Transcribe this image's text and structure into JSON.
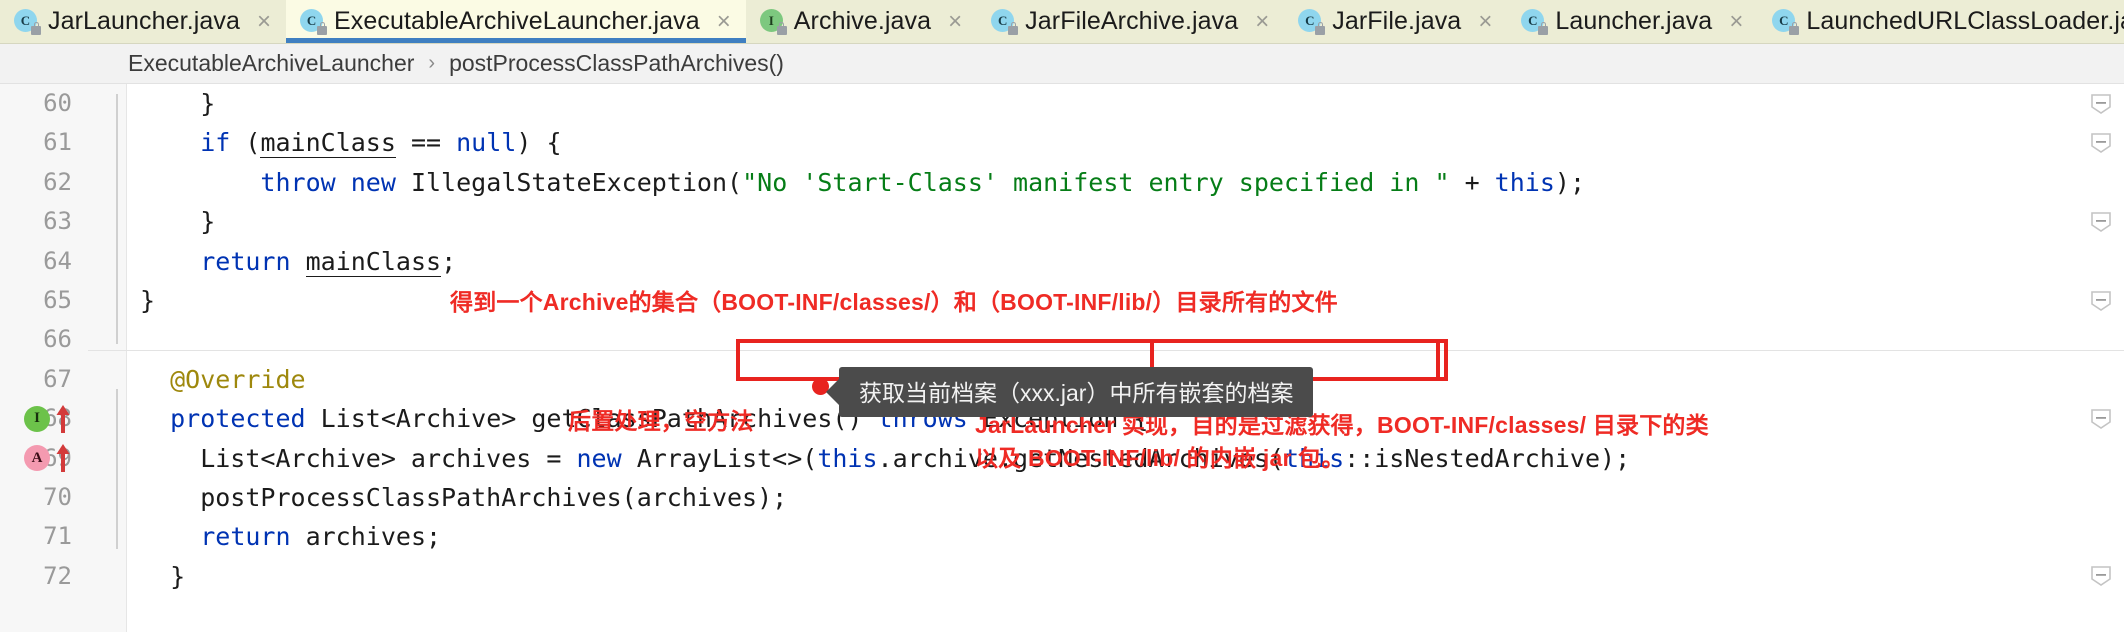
{
  "tabs": [
    {
      "label": "JarLauncher.java",
      "icon": "java-class-icon",
      "kind": "cls",
      "badge": "C",
      "active": false,
      "close": "×"
    },
    {
      "label": "ExecutableArchiveLauncher.java",
      "icon": "java-class-icon",
      "kind": "cls",
      "badge": "C",
      "active": true,
      "close": "×"
    },
    {
      "label": "Archive.java",
      "icon": "java-interface-icon",
      "kind": "iface",
      "badge": "I",
      "active": false,
      "close": "×"
    },
    {
      "label": "JarFileArchive.java",
      "icon": "java-class-icon",
      "kind": "cls",
      "badge": "C",
      "active": false,
      "close": "×"
    },
    {
      "label": "JarFile.java",
      "icon": "java-class-icon",
      "kind": "cls",
      "badge": "C",
      "active": false,
      "close": "×"
    },
    {
      "label": "Launcher.java",
      "icon": "java-class-icon",
      "kind": "cls",
      "badge": "C",
      "active": false,
      "close": "×"
    },
    {
      "label": "LaunchedURLClassLoader.java",
      "icon": "java-class-icon",
      "kind": "cls",
      "badge": "C",
      "active": false,
      "close": ""
    }
  ],
  "breadcrumb": {
    "class": "ExecutableArchiveLauncher",
    "separator": "›",
    "member": "postProcessClassPathArchives()"
  },
  "editor": {
    "lines": [
      {
        "num": "60",
        "indent": 0
      },
      {
        "num": "61",
        "indent": 0
      },
      {
        "num": "62",
        "indent": 0
      },
      {
        "num": "63",
        "indent": 0
      },
      {
        "num": "64",
        "indent": 0
      },
      {
        "num": "65",
        "indent": 0
      },
      {
        "num": "66",
        "indent": 0
      },
      {
        "num": "67",
        "indent": 0
      },
      {
        "num": "68",
        "indent": 0
      },
      {
        "num": "69",
        "indent": 0
      },
      {
        "num": "70",
        "indent": 0
      },
      {
        "num": "71",
        "indent": 0
      },
      {
        "num": "72",
        "indent": 0
      }
    ],
    "gutter_markers": {
      "line68": {
        "badge": "I",
        "name": "implemented-method-marker",
        "arrow": "red-up-arrow"
      },
      "line69": {
        "badge": "A",
        "name": "overridden-method-marker",
        "arrow": "red-up-arrow"
      }
    }
  },
  "annotations": {
    "line67_note": "得到一个Archive的集合（BOOT-INF/classes/）和（BOOT-INF/lib/）目录所有的文件",
    "line71_note": "后置处理，空方法",
    "bottom_note_line1": "JarLauncher 实现，目的是过滤获得，BOOT-INF/classes/ 目录下的类",
    "bottom_note_line2": "以及 BOOT-INF/lib/ 的内嵌 jar 包。",
    "tooltip": "获取当前档案（xxx.jar）中所有嵌套的档案"
  },
  "code": {
    "l60": {
      "seg": [
        {
          "t": "    }",
          "c": "pl"
        }
      ]
    },
    "l61": {
      "seg": [
        {
          "t": "    ",
          "c": "pl"
        },
        {
          "t": "if",
          "c": "kw"
        },
        {
          "t": " (",
          "c": "pl"
        },
        {
          "t": "mainClass",
          "c": "fld"
        },
        {
          "t": " == ",
          "c": "pl"
        },
        {
          "t": "null",
          "c": "kw"
        },
        {
          "t": ") {",
          "c": "pl"
        }
      ]
    },
    "l62": {
      "seg": [
        {
          "t": "        ",
          "c": "pl"
        },
        {
          "t": "throw",
          "c": "kw"
        },
        {
          "t": " ",
          "c": "pl"
        },
        {
          "t": "new",
          "c": "kw"
        },
        {
          "t": " IllegalStateException(",
          "c": "pl"
        },
        {
          "t": "\"No 'Start-Class' manifest entry specified in \"",
          "c": "str"
        },
        {
          "t": " + ",
          "c": "pl"
        },
        {
          "t": "this",
          "c": "kw"
        },
        {
          "t": ");",
          "c": "pl"
        }
      ]
    },
    "l63": {
      "seg": [
        {
          "t": "    }",
          "c": "pl"
        }
      ]
    },
    "l64": {
      "seg": [
        {
          "t": "    ",
          "c": "pl"
        },
        {
          "t": "return",
          "c": "kw"
        },
        {
          "t": " ",
          "c": "pl"
        },
        {
          "t": "mainClass",
          "c": "fld"
        },
        {
          "t": ";",
          "c": "pl"
        }
      ]
    },
    "l65": {
      "seg": [
        {
          "t": "}",
          "c": "pl"
        }
      ]
    },
    "l66": {
      "seg": [
        {
          "t": "",
          "c": "pl"
        }
      ]
    },
    "l67": {
      "seg": [
        {
          "t": "  ",
          "c": "pl"
        },
        {
          "t": "@Override",
          "c": "ann"
        }
      ]
    },
    "l68": {
      "seg": [
        {
          "t": "  ",
          "c": "pl"
        },
        {
          "t": "protected",
          "c": "kw"
        },
        {
          "t": " List<Archive> getClassPathArchives() ",
          "c": "pl"
        },
        {
          "t": "throws",
          "c": "kw"
        },
        {
          "t": " Exception {",
          "c": "pl"
        }
      ]
    },
    "l69": {
      "seg": [
        {
          "t": "    List<Archive> archives = ",
          "c": "pl"
        },
        {
          "t": "new",
          "c": "kw"
        },
        {
          "t": " ArrayList<>(",
          "c": "pl"
        },
        {
          "t": "this",
          "c": "kw"
        },
        {
          "t": ".archive.getNestedArchives(",
          "c": "pl"
        },
        {
          "t": "this",
          "c": "kw"
        },
        {
          "t": "::isNestedArchive);",
          "c": "pl"
        }
      ]
    },
    "l70": {
      "seg": [
        {
          "t": "    postProcessClassPathArchives(archives);",
          "c": "pl"
        }
      ]
    },
    "l71": {
      "seg": [
        {
          "t": "    ",
          "c": "pl"
        },
        {
          "t": "return",
          "c": "kw"
        },
        {
          "t": " archives;",
          "c": "pl"
        }
      ]
    },
    "l72": {
      "seg": [
        {
          "t": "  }",
          "c": "pl"
        }
      ]
    }
  },
  "colors": {
    "tab_bar_bg": "#ecedd5",
    "active_tab_bg": "#fbfbe4",
    "active_tab_underline": "#3f7fc1",
    "keyword": "#0033b3",
    "string": "#067d17",
    "annotation_kw": "#9e880d",
    "red_note": "#ef2b25",
    "red_box": "#e8231f",
    "tooltip_bg": "#4b4b4b"
  }
}
